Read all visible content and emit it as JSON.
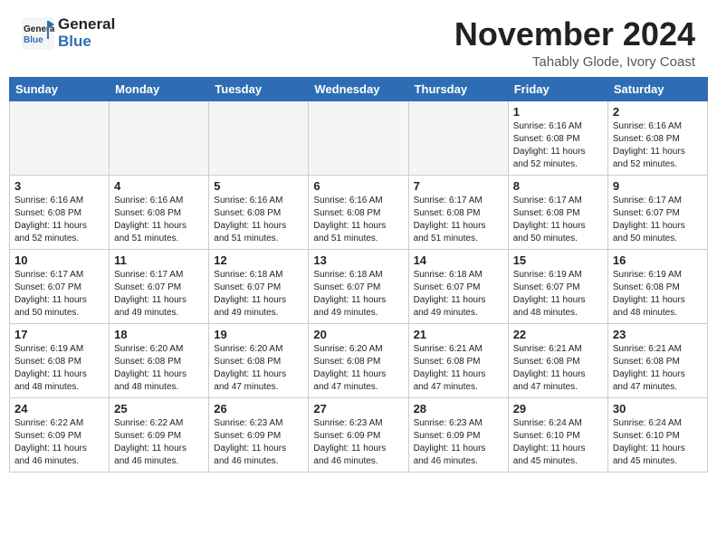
{
  "logo": {
    "general": "General",
    "blue": "Blue"
  },
  "header": {
    "month": "November 2024",
    "location": "Tahably Glode, Ivory Coast"
  },
  "weekdays": [
    "Sunday",
    "Monday",
    "Tuesday",
    "Wednesday",
    "Thursday",
    "Friday",
    "Saturday"
  ],
  "weeks": [
    [
      {
        "day": "",
        "info": ""
      },
      {
        "day": "",
        "info": ""
      },
      {
        "day": "",
        "info": ""
      },
      {
        "day": "",
        "info": ""
      },
      {
        "day": "",
        "info": ""
      },
      {
        "day": "1",
        "info": "Sunrise: 6:16 AM\nSunset: 6:08 PM\nDaylight: 11 hours\nand 52 minutes."
      },
      {
        "day": "2",
        "info": "Sunrise: 6:16 AM\nSunset: 6:08 PM\nDaylight: 11 hours\nand 52 minutes."
      }
    ],
    [
      {
        "day": "3",
        "info": "Sunrise: 6:16 AM\nSunset: 6:08 PM\nDaylight: 11 hours\nand 52 minutes."
      },
      {
        "day": "4",
        "info": "Sunrise: 6:16 AM\nSunset: 6:08 PM\nDaylight: 11 hours\nand 51 minutes."
      },
      {
        "day": "5",
        "info": "Sunrise: 6:16 AM\nSunset: 6:08 PM\nDaylight: 11 hours\nand 51 minutes."
      },
      {
        "day": "6",
        "info": "Sunrise: 6:16 AM\nSunset: 6:08 PM\nDaylight: 11 hours\nand 51 minutes."
      },
      {
        "day": "7",
        "info": "Sunrise: 6:17 AM\nSunset: 6:08 PM\nDaylight: 11 hours\nand 51 minutes."
      },
      {
        "day": "8",
        "info": "Sunrise: 6:17 AM\nSunset: 6:08 PM\nDaylight: 11 hours\nand 50 minutes."
      },
      {
        "day": "9",
        "info": "Sunrise: 6:17 AM\nSunset: 6:07 PM\nDaylight: 11 hours\nand 50 minutes."
      }
    ],
    [
      {
        "day": "10",
        "info": "Sunrise: 6:17 AM\nSunset: 6:07 PM\nDaylight: 11 hours\nand 50 minutes."
      },
      {
        "day": "11",
        "info": "Sunrise: 6:17 AM\nSunset: 6:07 PM\nDaylight: 11 hours\nand 49 minutes."
      },
      {
        "day": "12",
        "info": "Sunrise: 6:18 AM\nSunset: 6:07 PM\nDaylight: 11 hours\nand 49 minutes."
      },
      {
        "day": "13",
        "info": "Sunrise: 6:18 AM\nSunset: 6:07 PM\nDaylight: 11 hours\nand 49 minutes."
      },
      {
        "day": "14",
        "info": "Sunrise: 6:18 AM\nSunset: 6:07 PM\nDaylight: 11 hours\nand 49 minutes."
      },
      {
        "day": "15",
        "info": "Sunrise: 6:19 AM\nSunset: 6:07 PM\nDaylight: 11 hours\nand 48 minutes."
      },
      {
        "day": "16",
        "info": "Sunrise: 6:19 AM\nSunset: 6:08 PM\nDaylight: 11 hours\nand 48 minutes."
      }
    ],
    [
      {
        "day": "17",
        "info": "Sunrise: 6:19 AM\nSunset: 6:08 PM\nDaylight: 11 hours\nand 48 minutes."
      },
      {
        "day": "18",
        "info": "Sunrise: 6:20 AM\nSunset: 6:08 PM\nDaylight: 11 hours\nand 48 minutes."
      },
      {
        "day": "19",
        "info": "Sunrise: 6:20 AM\nSunset: 6:08 PM\nDaylight: 11 hours\nand 47 minutes."
      },
      {
        "day": "20",
        "info": "Sunrise: 6:20 AM\nSunset: 6:08 PM\nDaylight: 11 hours\nand 47 minutes."
      },
      {
        "day": "21",
        "info": "Sunrise: 6:21 AM\nSunset: 6:08 PM\nDaylight: 11 hours\nand 47 minutes."
      },
      {
        "day": "22",
        "info": "Sunrise: 6:21 AM\nSunset: 6:08 PM\nDaylight: 11 hours\nand 47 minutes."
      },
      {
        "day": "23",
        "info": "Sunrise: 6:21 AM\nSunset: 6:08 PM\nDaylight: 11 hours\nand 47 minutes."
      }
    ],
    [
      {
        "day": "24",
        "info": "Sunrise: 6:22 AM\nSunset: 6:09 PM\nDaylight: 11 hours\nand 46 minutes."
      },
      {
        "day": "25",
        "info": "Sunrise: 6:22 AM\nSunset: 6:09 PM\nDaylight: 11 hours\nand 46 minutes."
      },
      {
        "day": "26",
        "info": "Sunrise: 6:23 AM\nSunset: 6:09 PM\nDaylight: 11 hours\nand 46 minutes."
      },
      {
        "day": "27",
        "info": "Sunrise: 6:23 AM\nSunset: 6:09 PM\nDaylight: 11 hours\nand 46 minutes."
      },
      {
        "day": "28",
        "info": "Sunrise: 6:23 AM\nSunset: 6:09 PM\nDaylight: 11 hours\nand 46 minutes."
      },
      {
        "day": "29",
        "info": "Sunrise: 6:24 AM\nSunset: 6:10 PM\nDaylight: 11 hours\nand 45 minutes."
      },
      {
        "day": "30",
        "info": "Sunrise: 6:24 AM\nSunset: 6:10 PM\nDaylight: 11 hours\nand 45 minutes."
      }
    ]
  ]
}
